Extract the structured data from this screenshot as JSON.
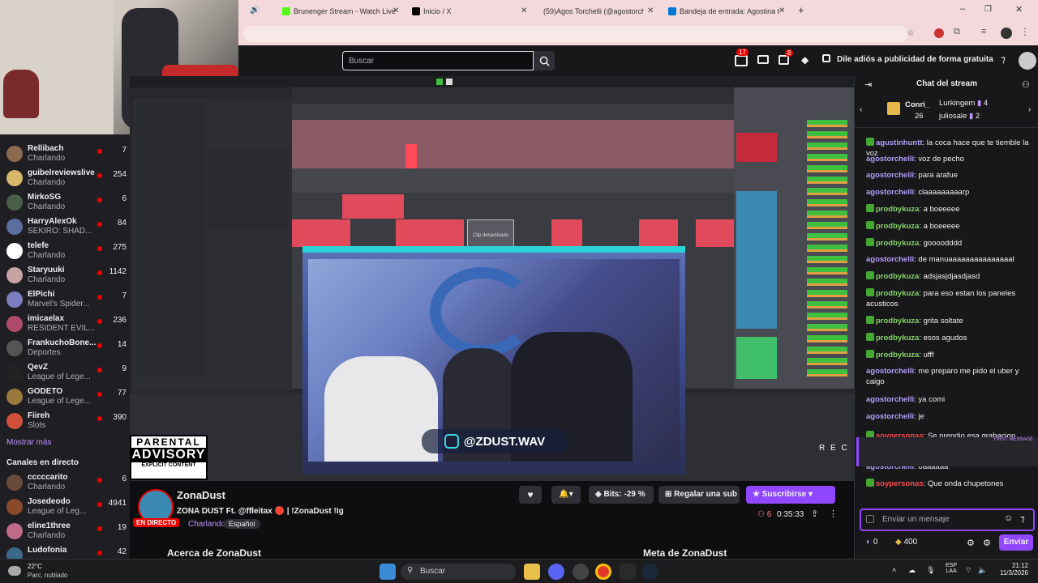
{
  "browser": {
    "tabs": [
      {
        "title": "Brunenger Stream - Watch Live",
        "color": "#53fc18"
      },
      {
        "title": "Inicio / X",
        "color": "#000000"
      },
      {
        "title": "(59)Agos Torchelli (@agostorch",
        "color": "#000000"
      },
      {
        "title": "Bandeja de entrada: Agostina t",
        "color": "#0078d4"
      }
    ],
    "new_tab": "+"
  },
  "topnav": {
    "search_placeholder": "Buscar",
    "notif_count": "17",
    "whisper_count": "8",
    "ad_free": "Dile adiós a publicidad de forma gratuita"
  },
  "sidebar": {
    "channels": [
      {
        "name": "Rellibach",
        "game": "Charlando",
        "viewers": "7",
        "color": "#8c6a4f"
      },
      {
        "name": "guibelreviewslive",
        "game": "Charlando",
        "viewers": "254",
        "color": "#d8b86a"
      },
      {
        "name": "MirkoSG",
        "game": "Charlando",
        "viewers": "6",
        "color": "#4a5f4a"
      },
      {
        "name": "HarryAlexOk",
        "game": "SEKIRO: SHAD...",
        "viewers": "84",
        "color": "#5a6fa0"
      },
      {
        "name": "telefe",
        "game": "Charlando",
        "viewers": "275",
        "color": "#ffffff"
      },
      {
        "name": "Staryuuki",
        "game": "Charlando",
        "viewers": "1142",
        "color": "#c7a3a3"
      },
      {
        "name": "ElPichi",
        "game": "Marvel's Spider...",
        "viewers": "7",
        "color": "#7b7fbf"
      },
      {
        "name": "imicaelax",
        "game": "RESIDENT EVIL...",
        "viewers": "236",
        "color": "#b04a6a"
      },
      {
        "name": "FrankuchoBone...",
        "game": "Deportes",
        "viewers": "14",
        "color": "#555555"
      },
      {
        "name": "QevZ",
        "game": "League of Lege...",
        "viewers": "9",
        "color": "#222222"
      },
      {
        "name": "GODETO",
        "game": "League of Lege...",
        "viewers": "77",
        "color": "#9a7a3a"
      },
      {
        "name": "Fiireh",
        "game": "Slots",
        "viewers": "390",
        "color": "#d0503a"
      }
    ],
    "show_more": "Mostrar más",
    "live_header": "Canales en directo",
    "live_channels": [
      {
        "name": "cccccarito",
        "game": "Charlando",
        "viewers": "6",
        "color": "#6a4a3a"
      },
      {
        "name": "Josedeodo",
        "game": "League of Leg...",
        "viewers": "4941",
        "color": "#8a4a2a"
      },
      {
        "name": "eline1three",
        "game": "Charlando",
        "viewers": "19",
        "color": "#c06a8a"
      },
      {
        "name": "Ludofonia",
        "game": "",
        "viewers": "42",
        "color": "#3a6a8a"
      }
    ]
  },
  "stream": {
    "overlay_handle": "@ZDUST.WAV",
    "rec_label": "R E C",
    "advisory_line1": "PARENTAL",
    "advisory_line2": "ADVISORY",
    "advisory_line3": "EXPLICIT CONTENT",
    "clip_label": "Clip desactivado"
  },
  "channel": {
    "name": "ZonaDust",
    "title": "ZONA DUST Ft. @ffleitax 🔴 | !ZonaDust !Ig",
    "live_badge": "EN DIRECTO",
    "category": "Charlando",
    "tag": "Español",
    "bits": "Bits: -29 %",
    "gift": "Regalar una sub",
    "subscribe": "Suscribirse",
    "viewers": "6",
    "uptime": "0:35:33",
    "about": "Acerca de ZonaDust",
    "goal": "Meta de ZonaDust"
  },
  "chat": {
    "header": "Chat del stream",
    "hype": [
      {
        "name": "Conri_",
        "value": "26"
      },
      {
        "name": "Lurkingem",
        "value": "4"
      },
      {
        "name": "juliosale",
        "value": "2"
      }
    ],
    "messages": [
      {
        "user": "agustinhuntt",
        "text": "la coca hace que te tiemble la voz",
        "color": "#b69dfb",
        "badge": true
      },
      {
        "user": "agostorchelli",
        "text": "voz de pecho",
        "color": "#b69dfb",
        "badge": false
      },
      {
        "user": "agostorchelli",
        "text": "para arafue",
        "color": "#b69dfb",
        "badge": false
      },
      {
        "user": "agostorchelli",
        "text": "claaaaaaaaarp",
        "color": "#b69dfb",
        "badge": false
      },
      {
        "user": "prodbykuza",
        "text": "a boeeeee",
        "color": "#86d26a",
        "badge": true
      },
      {
        "user": "prodbykuza",
        "text": "a boeeeee",
        "color": "#86d26a",
        "badge": true
      },
      {
        "user": "prodbykuza",
        "text": "goooodddd",
        "color": "#86d26a",
        "badge": true
      },
      {
        "user": "agostorchelli",
        "text": "de manuaaaaaaaaaaaaaaal",
        "color": "#b69dfb",
        "badge": false
      },
      {
        "user": "prodbykuza",
        "text": "adsjasjdjasdjasd",
        "color": "#86d26a",
        "badge": true
      },
      {
        "user": "prodbykuza",
        "text": "para eso estan los paneles acusticos",
        "color": "#86d26a",
        "badge": true
      },
      {
        "user": "prodbykuza",
        "text": "grita soltate",
        "color": "#86d26a",
        "badge": true
      },
      {
        "user": "prodbykuza",
        "text": "esos agudos",
        "color": "#86d26a",
        "badge": true
      },
      {
        "user": "prodbykuza",
        "text": "ufff",
        "color": "#86d26a",
        "badge": true
      },
      {
        "user": "agostorchelli",
        "text": "me preparo me pido el uber y caigo",
        "color": "#b69dfb",
        "badge": false
      },
      {
        "user": "agostorchelli",
        "text": "ya comi",
        "color": "#b69dfb",
        "badge": false
      },
      {
        "user": "agostorchelli",
        "text": "je",
        "color": "#b69dfb",
        "badge": false
      },
      {
        "user": "soypersonas",
        "text": "Se prendio esa grabacion chupete en ogt?",
        "color": "#ff4a4a",
        "badge": true
      },
      {
        "user": "agostorchelli",
        "text": "oaaaaaa",
        "color": "#b69dfb",
        "badge": false
      },
      {
        "user": "soypersonas",
        "text": "Que onda chupetones",
        "color": "#ff4a4a",
        "badge": true
      }
    ],
    "first_message": "FIRST MESSAGE",
    "input_placeholder": "Enviar un mensaje",
    "points": "0",
    "bits_count": "400",
    "send": "Enviar"
  },
  "taskbar": {
    "temp": "22°C",
    "weather": "Parc. nublado",
    "search": "Buscar",
    "lang1": "ESP",
    "lang2": "LAA",
    "time": "21:12",
    "date": "11/3/2026"
  }
}
